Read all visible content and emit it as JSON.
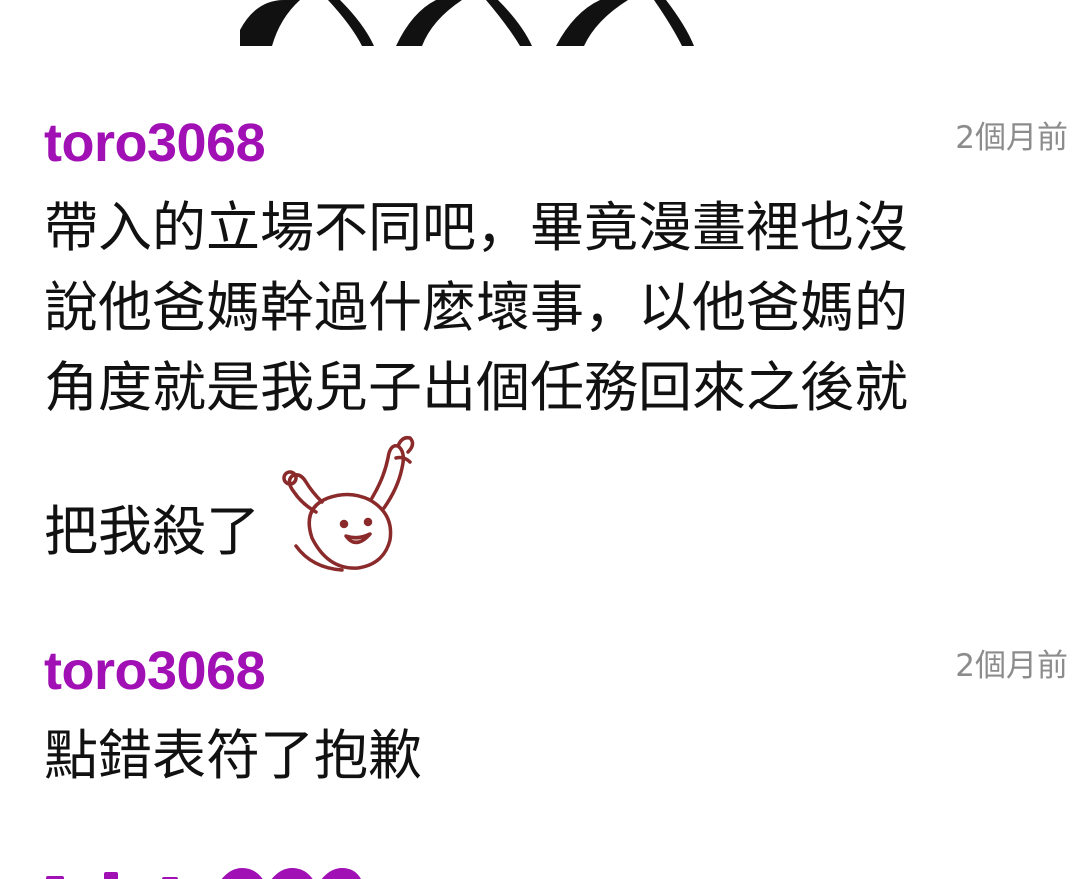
{
  "comments": [
    {
      "username": "toro3068",
      "time": "2個月前",
      "lines": [
        "帶入的立場不同吧，畢竟漫畫裡也沒",
        "說他爸媽幹過什麼壞事，以他爸媽的",
        "角度就是我兒子出個任務回來之後就",
        "把我殺了"
      ],
      "sticker_icon": "cheering-character-sticker"
    },
    {
      "username": "toro3068",
      "time": "2個月前",
      "text": "點錯表符了抱歉"
    }
  ],
  "colors": {
    "username": "#a010b4",
    "timestamp": "#8c8c8c",
    "text": "#111111",
    "sticker": "#8a2a2a"
  }
}
